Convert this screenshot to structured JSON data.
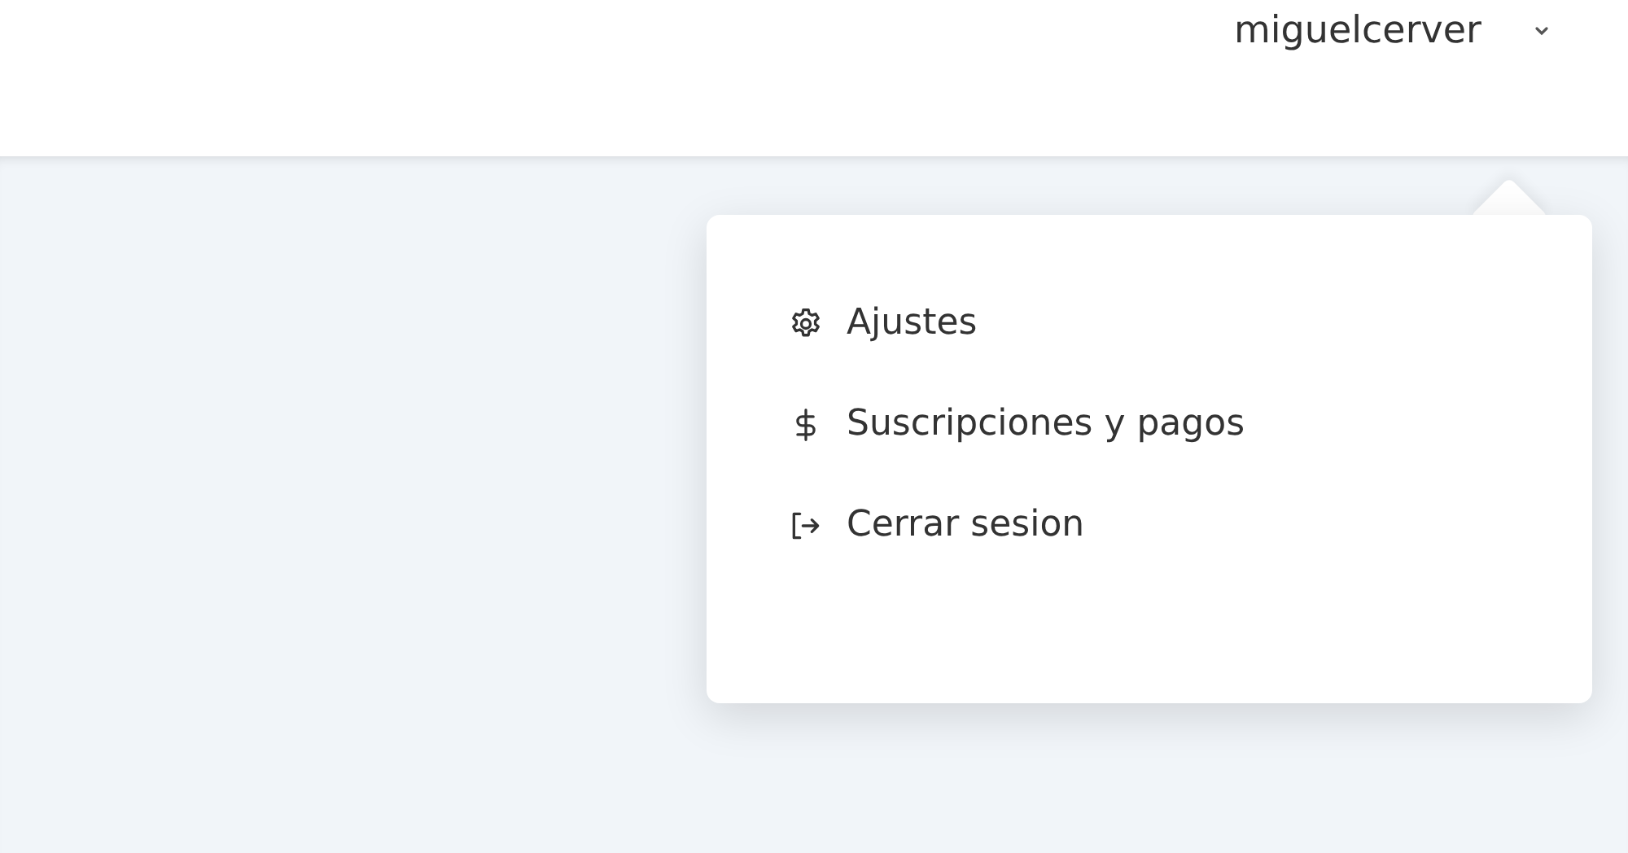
{
  "user_menu": {
    "username": "miguelcerver"
  },
  "dropdown": {
    "items": [
      {
        "kind": "settings",
        "label": "Ajustes"
      },
      {
        "kind": "billing",
        "label": "Suscripciones y pagos"
      },
      {
        "kind": "logout",
        "label": "Cerrar sesion"
      }
    ]
  }
}
